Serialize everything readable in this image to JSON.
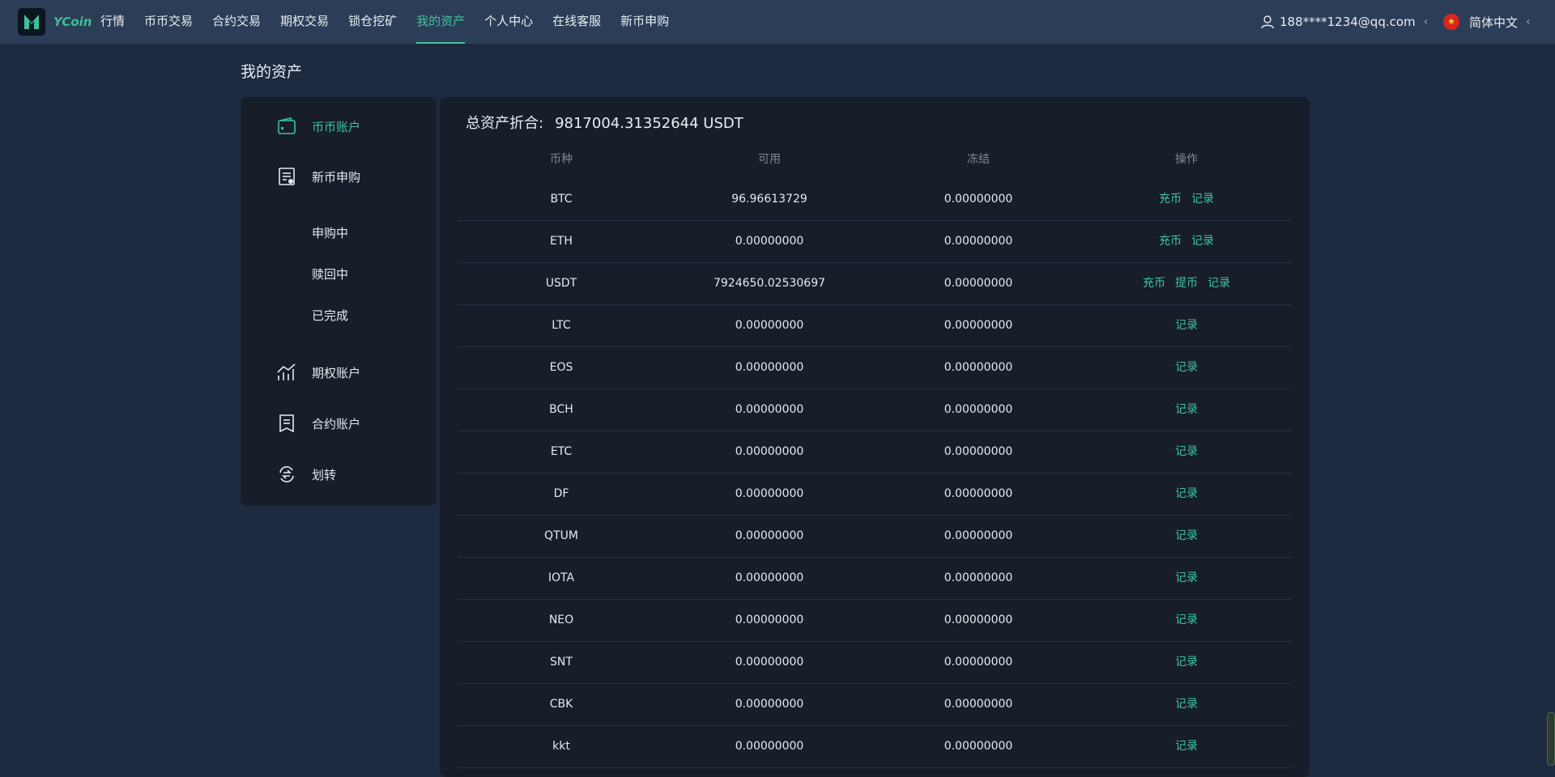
{
  "header": {
    "logo_text": "YCoin",
    "nav": [
      {
        "label": "行情",
        "active": false
      },
      {
        "label": "币币交易",
        "active": false
      },
      {
        "label": "合约交易",
        "active": false
      },
      {
        "label": "期权交易",
        "active": false
      },
      {
        "label": "锁仓挖矿",
        "active": false
      },
      {
        "label": "我的资产",
        "active": true
      },
      {
        "label": "个人中心",
        "active": false
      },
      {
        "label": "在线客服",
        "active": false
      },
      {
        "label": "新币申购",
        "active": false
      }
    ],
    "user_email": "188****1234@qq.com",
    "language": "简体中文",
    "accent_color": "#3dc49f"
  },
  "page_title": "我的资产",
  "sidebar": {
    "items": [
      {
        "label": "币币账户",
        "icon": "wallet-icon",
        "active": true
      },
      {
        "label": "新币申购",
        "icon": "subscription-icon",
        "active": false
      },
      {
        "label": "期权账户",
        "icon": "chart-icon",
        "active": false
      },
      {
        "label": "合约账户",
        "icon": "contract-icon",
        "active": false
      },
      {
        "label": "划转",
        "icon": "transfer-icon",
        "active": false
      }
    ],
    "subitems": [
      "申购中",
      "赎回中",
      "已完成"
    ]
  },
  "main": {
    "total_label": "总资产折合:",
    "total_value": "9817004.31352644 USDT",
    "columns": [
      "币种",
      "可用",
      "冻结",
      "操作"
    ],
    "rows": [
      {
        "coin": "BTC",
        "available": "96.96613729",
        "frozen": "0.00000000",
        "ops": [
          "充币",
          "记录"
        ]
      },
      {
        "coin": "ETH",
        "available": "0.00000000",
        "frozen": "0.00000000",
        "ops": [
          "充币",
          "记录"
        ]
      },
      {
        "coin": "USDT",
        "available": "7924650.02530697",
        "frozen": "0.00000000",
        "ops": [
          "充币",
          "提币",
          "记录"
        ]
      },
      {
        "coin": "LTC",
        "available": "0.00000000",
        "frozen": "0.00000000",
        "ops": [
          "记录"
        ]
      },
      {
        "coin": "EOS",
        "available": "0.00000000",
        "frozen": "0.00000000",
        "ops": [
          "记录"
        ]
      },
      {
        "coin": "BCH",
        "available": "0.00000000",
        "frozen": "0.00000000",
        "ops": [
          "记录"
        ]
      },
      {
        "coin": "ETC",
        "available": "0.00000000",
        "frozen": "0.00000000",
        "ops": [
          "记录"
        ]
      },
      {
        "coin": "DF",
        "available": "0.00000000",
        "frozen": "0.00000000",
        "ops": [
          "记录"
        ]
      },
      {
        "coin": "QTUM",
        "available": "0.00000000",
        "frozen": "0.00000000",
        "ops": [
          "记录"
        ]
      },
      {
        "coin": "IOTA",
        "available": "0.00000000",
        "frozen": "0.00000000",
        "ops": [
          "记录"
        ]
      },
      {
        "coin": "NEO",
        "available": "0.00000000",
        "frozen": "0.00000000",
        "ops": [
          "记录"
        ]
      },
      {
        "coin": "SNT",
        "available": "0.00000000",
        "frozen": "0.00000000",
        "ops": [
          "记录"
        ]
      },
      {
        "coin": "CBK",
        "available": "0.00000000",
        "frozen": "0.00000000",
        "ops": [
          "记录"
        ]
      },
      {
        "coin": "kkt",
        "available": "0.00000000",
        "frozen": "0.00000000",
        "ops": [
          "记录"
        ]
      }
    ]
  }
}
